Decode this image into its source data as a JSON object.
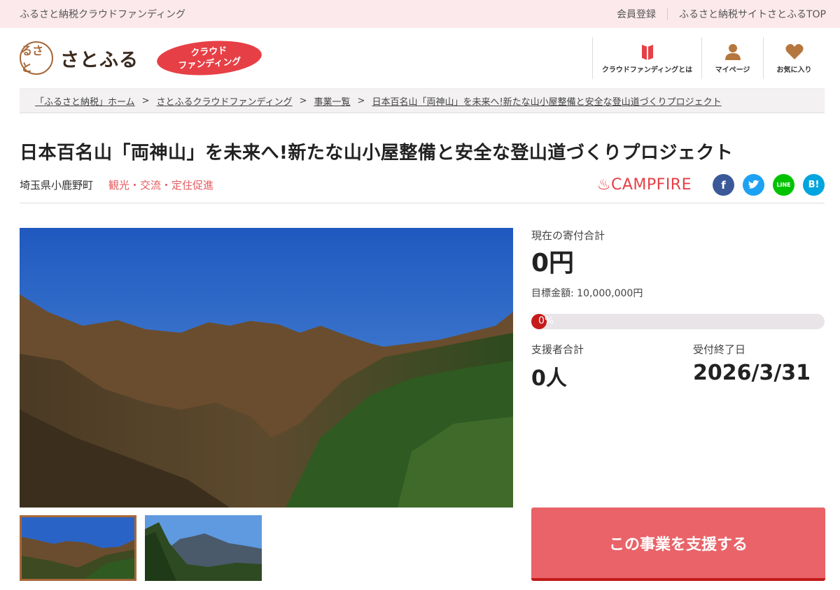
{
  "topbar": {
    "site_name": "ふるさと納税クラウドファンディング",
    "register": "会員登録",
    "top_link": "ふるさと納税サイトさとふるTOP"
  },
  "header": {
    "logo_mark": "るさと",
    "logo_text": "さとふる",
    "badge_line1": "クラウド",
    "badge_line2": "ファンディング",
    "nav": [
      {
        "label": "クラウドファンディングとは",
        "icon": "book-icon"
      },
      {
        "label": "マイページ",
        "icon": "user-icon"
      },
      {
        "label": "お気に入り",
        "icon": "heart-icon"
      }
    ]
  },
  "breadcrumb": [
    "「ふるさと納税」ホーム",
    "さとふるクラウドファンディング",
    "事業一覧",
    "日本百名山「両神山」を未来へ!新たな山小屋整備と安全な登山道づくりプロジェクト"
  ],
  "project": {
    "title": "日本百名山「両神山」を未来へ!新たな山小屋整備と安全な登山道づくりプロジェクト",
    "location": "埼玉県小鹿野町",
    "tags": "観光・交流・定住促進",
    "partner": "CAMPFIRE",
    "social": [
      {
        "name": "facebook",
        "label": "f",
        "color": "#3b5998"
      },
      {
        "name": "twitter",
        "label": "t",
        "color": "#1da1f2"
      },
      {
        "name": "line",
        "label": "LINE",
        "color": "#00c300"
      },
      {
        "name": "hatena",
        "label": "B!",
        "color": "#00a4de"
      }
    ]
  },
  "funding": {
    "current_label": "現在の寄付合計",
    "current_value": "0円",
    "goal_text": "目標金額: 10,000,000円",
    "progress_percent": 0,
    "progress_text": "0%",
    "supporters_label": "支援者合計",
    "supporters_value": "0人",
    "deadline_label": "受付終了日",
    "deadline_value": "2026/3/31",
    "support_button": "この事業を支援する"
  },
  "colors": {
    "accent": "#e96368",
    "brand_brown": "#a7683a",
    "topbar_bg": "#fbe9ec"
  }
}
